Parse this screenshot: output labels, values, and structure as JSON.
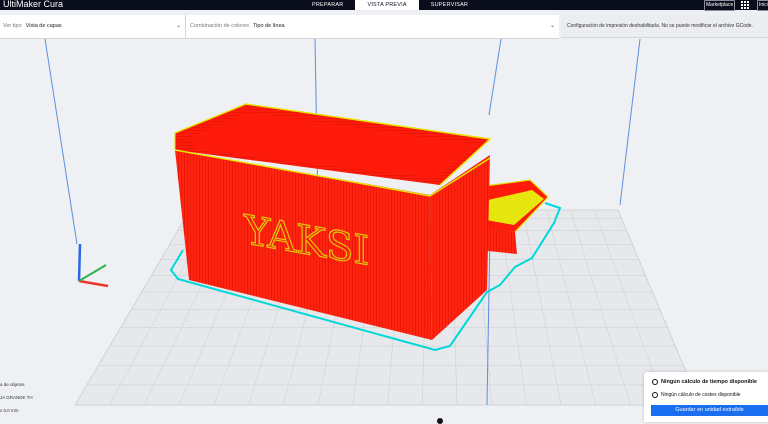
{
  "app": {
    "title": "UltiMaker Cura"
  },
  "tabs": [
    {
      "label": "PREPARAR",
      "active": false
    },
    {
      "label": "VISTA PREVIA",
      "active": true
    },
    {
      "label": "SUPERVISAR",
      "active": false
    }
  ],
  "header": {
    "marketplace_label": "Marketplace",
    "signin_label": "Iniciar sesión"
  },
  "toolbar": {
    "view_type_label": "Ver tipo",
    "view_type_value": "Vista de capas",
    "color_scheme_label": "Combinación de colores",
    "color_scheme_value": "Tipo de línea"
  },
  "notice": {
    "text": "Configuración de impresión deshabilitada. No se puede modificar el archivo GCode."
  },
  "object_panel": {
    "list_label": "a de objetos",
    "object_name": "JA GRANDE TH",
    "dimensions": "x 0,0 mm"
  },
  "print_panel": {
    "time_text": "Ningún cálculo de tiempo disponible",
    "cost_text": "Ningún cálculo de costes disponible",
    "save_label": "Guardar en unidad extraíble"
  },
  "viewport": {
    "embossed_text": "YAKSI",
    "colors": {
      "wall": "#ff1b0b",
      "top_skin": "#e8e800",
      "skirt": "#00d8d8",
      "build_plate": "#e6e8ec",
      "grid": "#c9ccd2",
      "build_volume": "#5b8fe0",
      "axis_x": "#e8362a",
      "axis_y": "#2fb24a",
      "axis_z": "#2966e8"
    }
  }
}
